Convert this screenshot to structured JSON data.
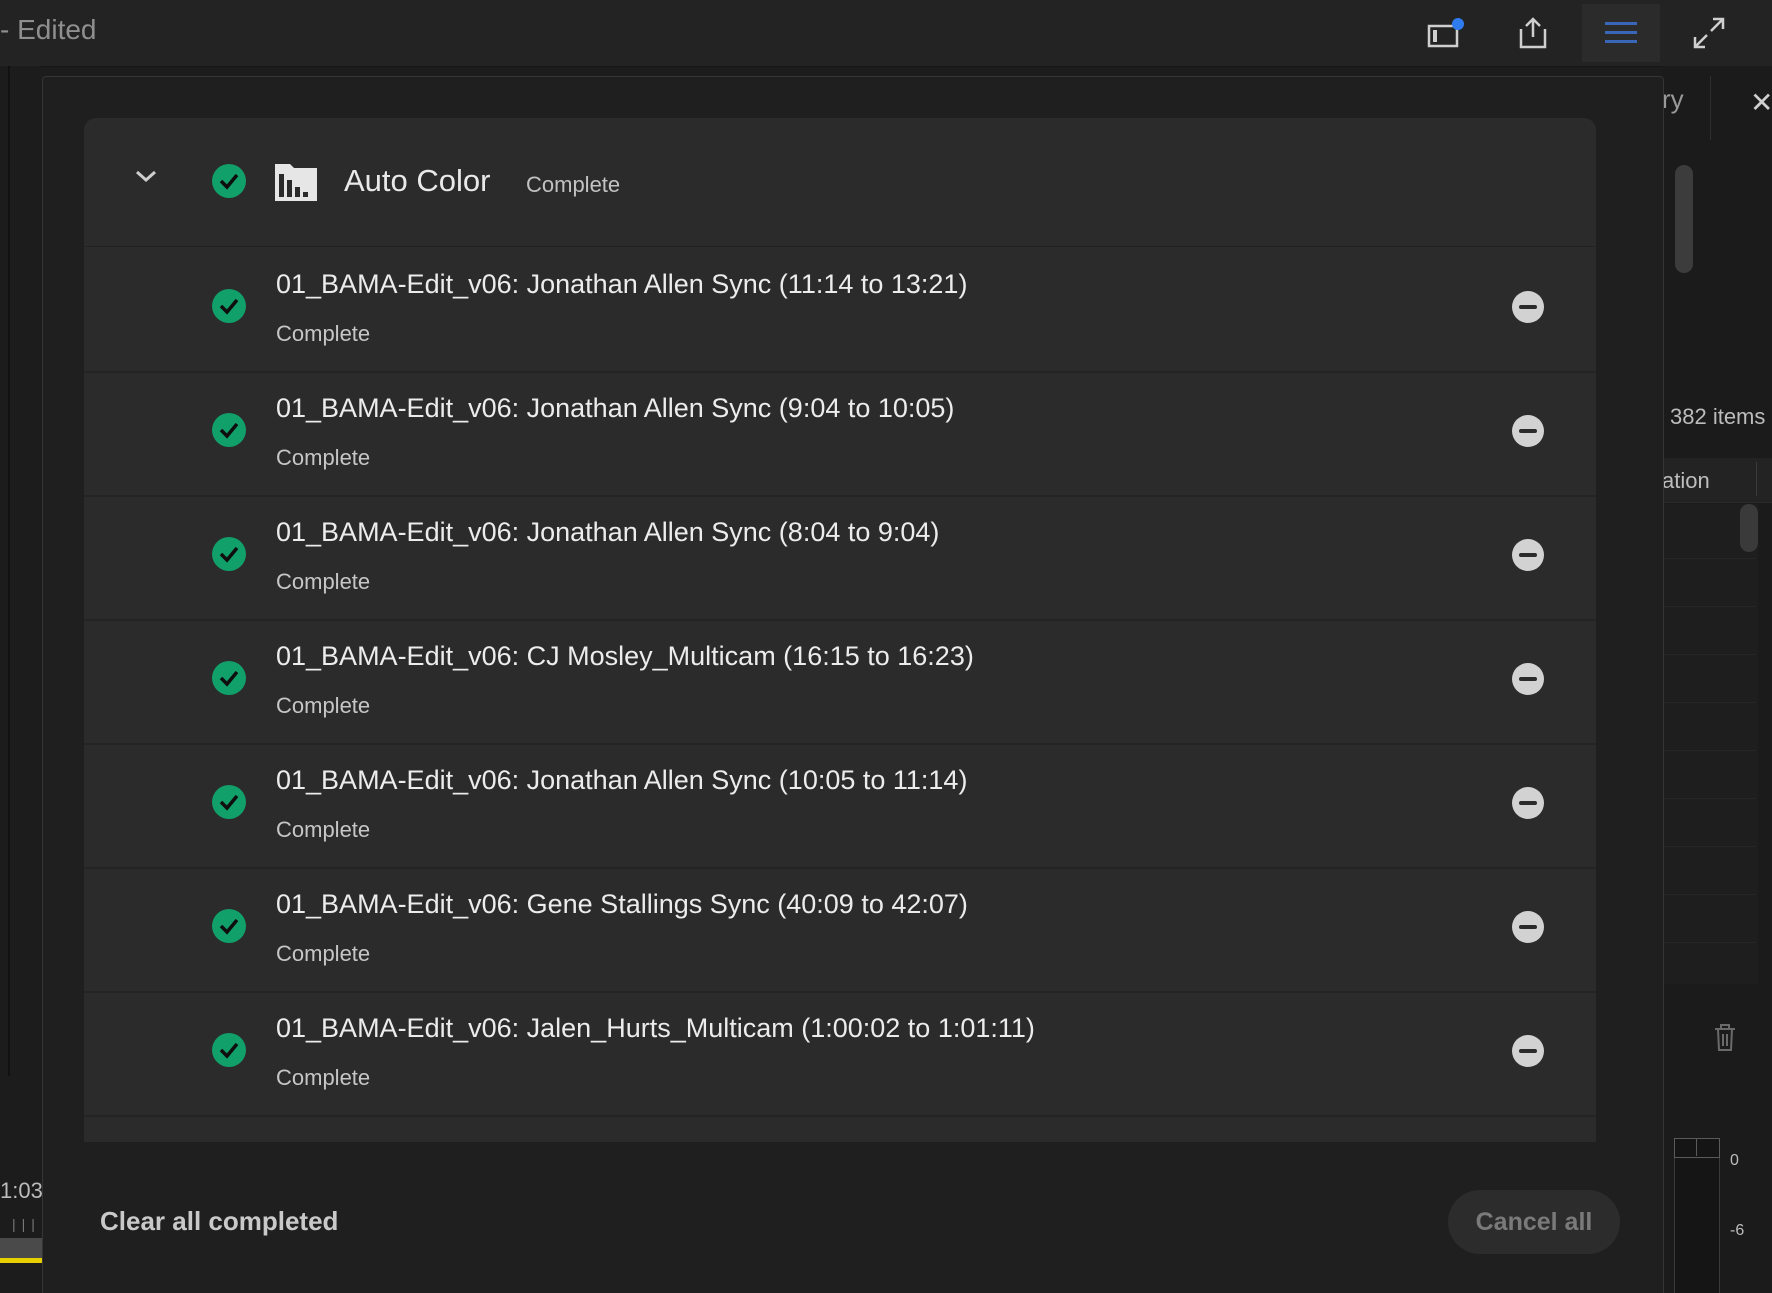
{
  "window": {
    "title": "- Edited"
  },
  "background": {
    "panel_tab_fragment": "ry",
    "item_count": "382 items",
    "column_fragment": "ation",
    "timeline_time": "1:03",
    "meter_labels": [
      "0",
      "-6"
    ]
  },
  "queue": {
    "group": {
      "title": "Auto Color",
      "status": "Complete"
    },
    "items": [
      {
        "title": "01_BAMA-Edit_v06: Jonathan Allen Sync (11:14 to 13:21)",
        "status": "Complete"
      },
      {
        "title": "01_BAMA-Edit_v06: Jonathan Allen Sync (9:04 to 10:05)",
        "status": "Complete"
      },
      {
        "title": "01_BAMA-Edit_v06: Jonathan Allen Sync (8:04 to 9:04)",
        "status": "Complete"
      },
      {
        "title": "01_BAMA-Edit_v06: CJ Mosley_Multicam (16:15 to 16:23)",
        "status": "Complete"
      },
      {
        "title": "01_BAMA-Edit_v06: Jonathan Allen Sync (10:05 to 11:14)",
        "status": "Complete"
      },
      {
        "title": "01_BAMA-Edit_v06: Gene Stallings Sync (40:09 to 42:07)",
        "status": "Complete"
      },
      {
        "title": "01_BAMA-Edit_v06: Jalen_Hurts_Multicam (1:00:02 to 1:01:11)",
        "status": "Complete"
      }
    ],
    "clear_label": "Clear all completed",
    "cancel_label": "Cancel all"
  },
  "colors": {
    "success": "#12a06a",
    "notification": "#2f7bf0",
    "active_icon": "#3a66b8"
  }
}
